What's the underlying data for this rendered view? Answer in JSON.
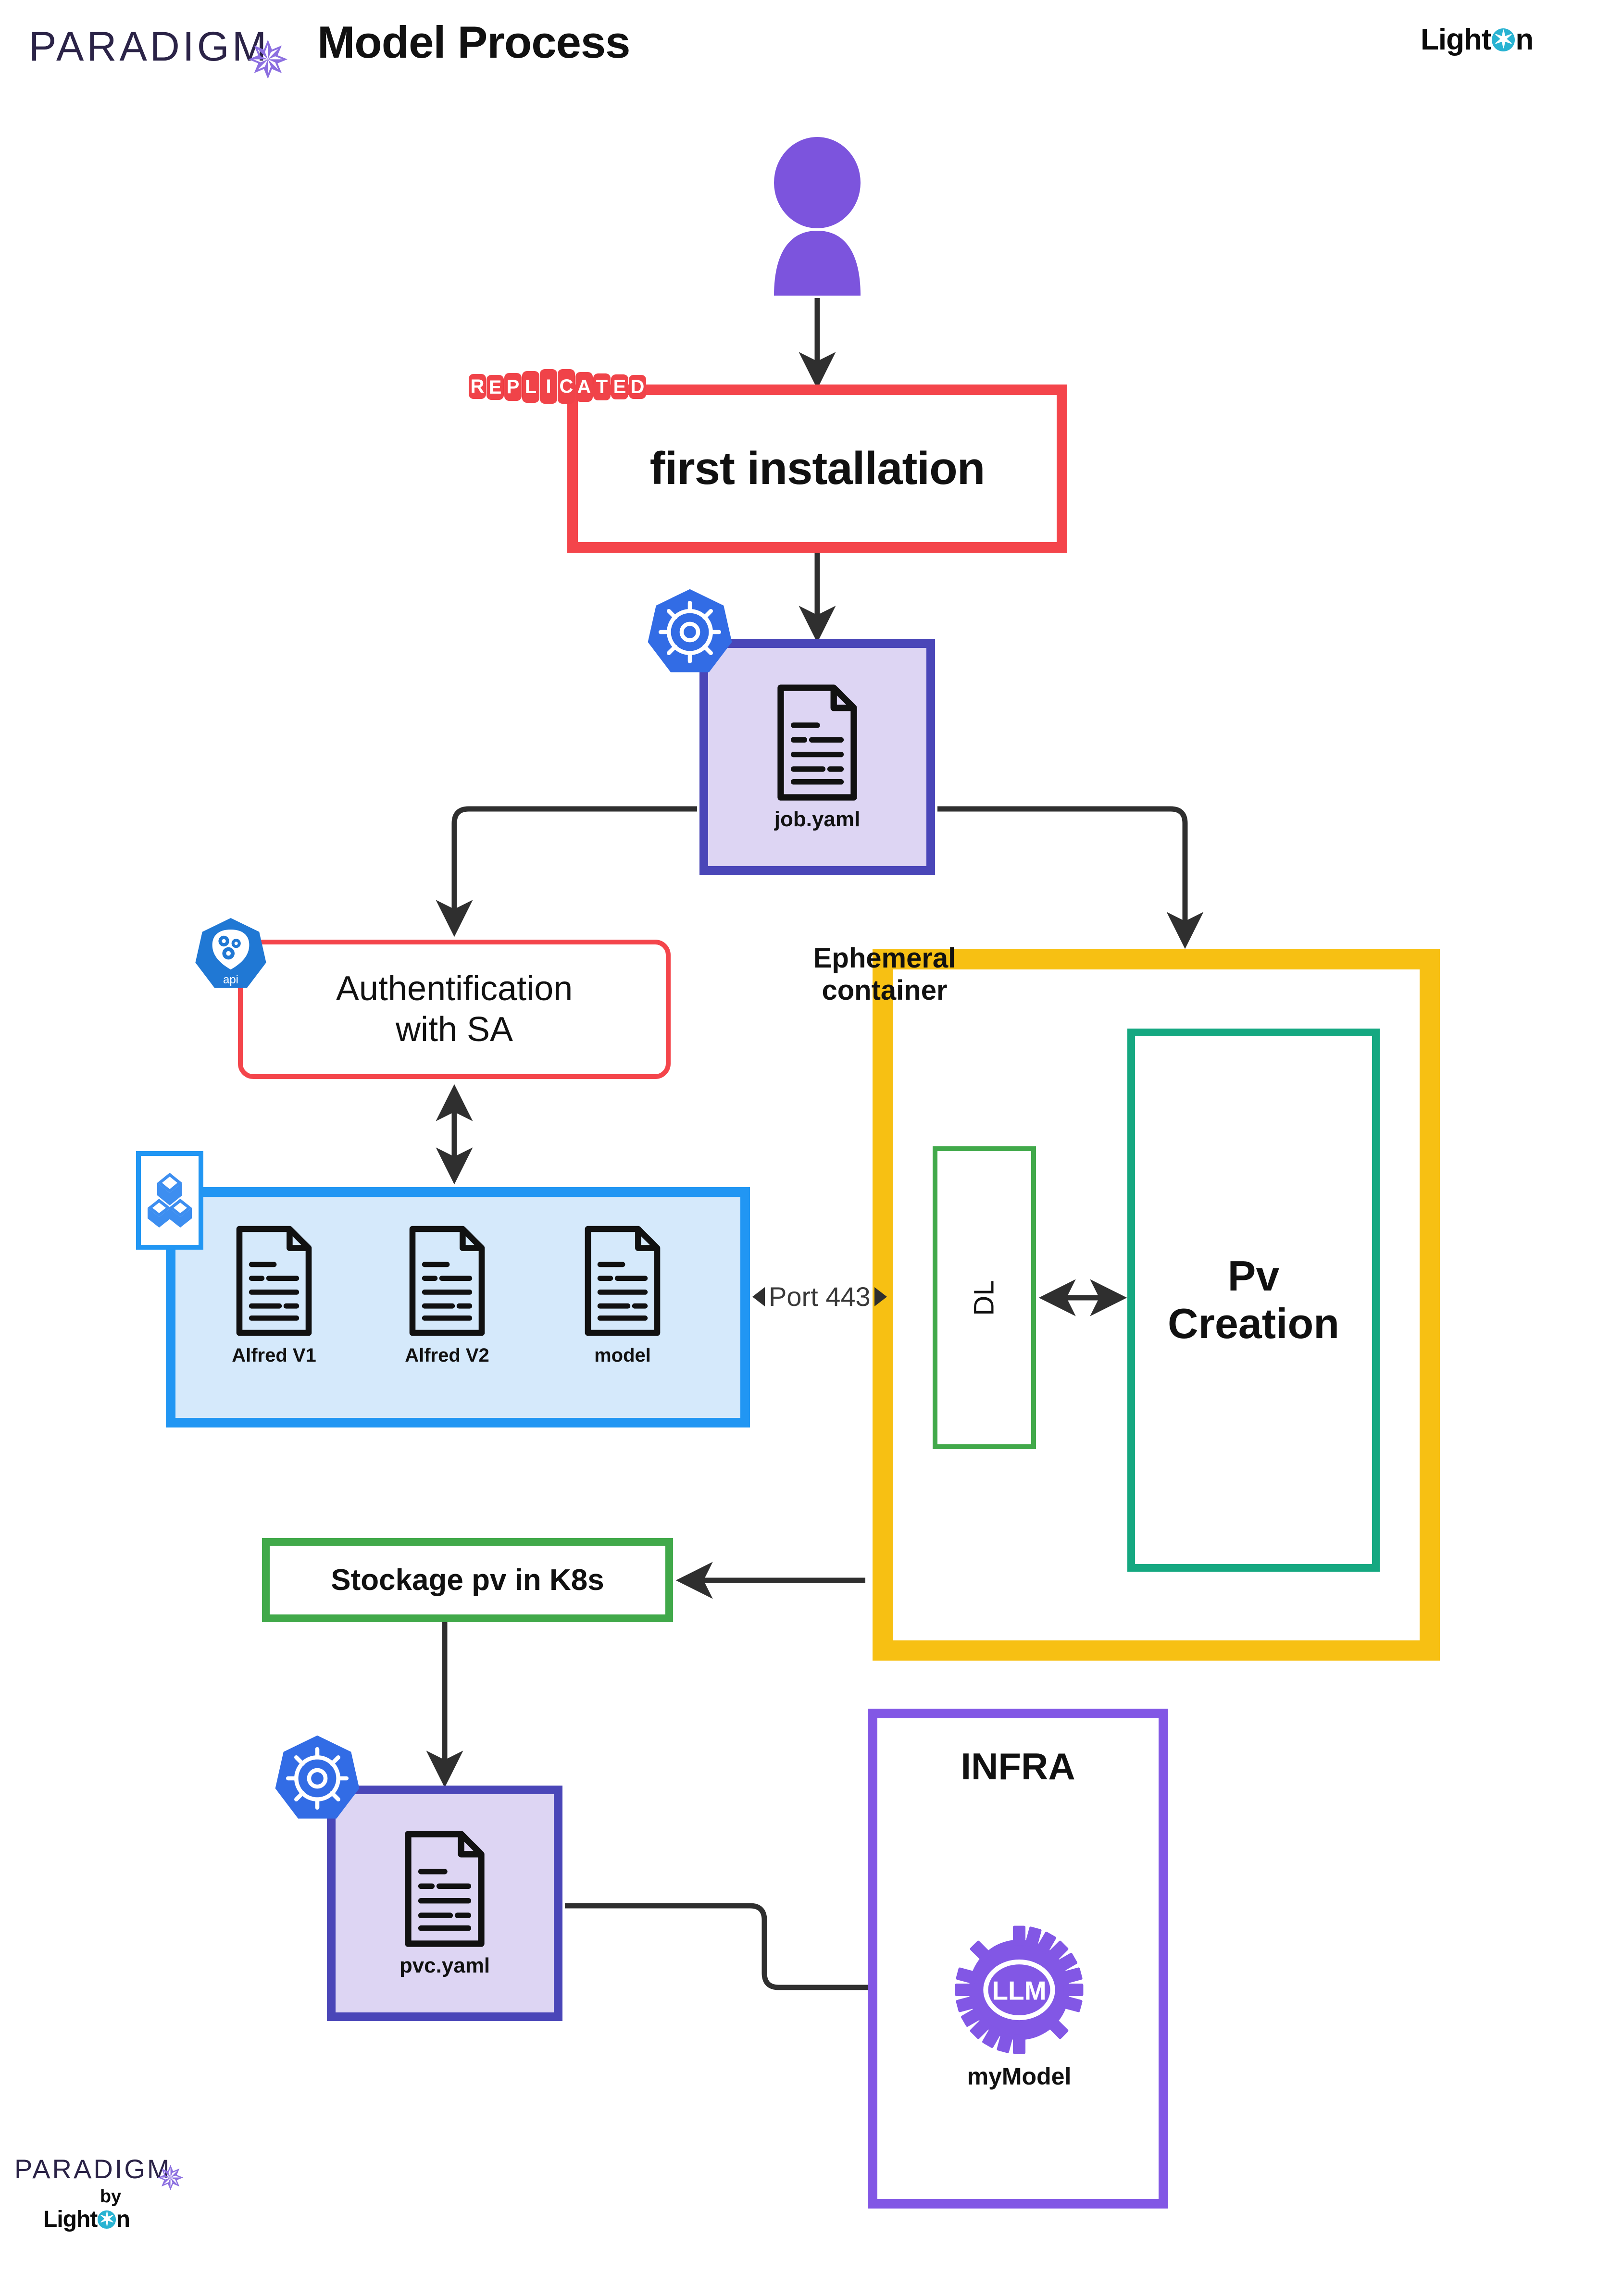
{
  "header": {
    "brand": "PARADIGM",
    "brand_star_icon": "four-point-star-icon",
    "title": "Model Process",
    "company_logo": "LightOn",
    "company_logo_pre": "Light",
    "company_logo_post": "n"
  },
  "colors": {
    "replicated_red": "#f04349",
    "first_install_border": "#f4454b",
    "k8s_blue": "#326ce5",
    "yaml_border": "#4a46b8",
    "yaml_fill": "#ddd5f3",
    "auth_border": "#f4454b",
    "store_border": "#2196f3",
    "store_fill": "#d5e9fb",
    "ephemeral_yellow": "#f7c013",
    "dl_green": "#41a94a",
    "pv_teal": "#15a881",
    "stockage_green": "#41a94a",
    "infra_purple": "#8257e5",
    "user_purple": "#7c54dd",
    "lighton_cyan": "#29b3d2",
    "paradigm_navy": "#2b2347",
    "connector_dark": "#2f2f2f"
  },
  "nodes": {
    "user": {
      "icon": "user-avatar-icon"
    },
    "replicated_badge": {
      "letters": [
        "R",
        "E",
        "P",
        "L",
        "I",
        "C",
        "A",
        "T",
        "E",
        "D"
      ],
      "text": "REPLICATED"
    },
    "first_installation": {
      "label": "first installation"
    },
    "job_yaml": {
      "label": "job.yaml",
      "icon": "document-icon",
      "platform_icon": "kubernetes-icon"
    },
    "authentification": {
      "line1": "Authentification",
      "line2": "with SA",
      "platform_icon": "kubernetes-api-icon",
      "platform_icon_label": "api"
    },
    "storage": {
      "icon": "storage-blocks-icon",
      "files": [
        {
          "label": "Alfred V1",
          "icon": "document-icon"
        },
        {
          "label": "Alfred V2",
          "icon": "document-icon"
        },
        {
          "label": "model",
          "icon": "document-icon"
        }
      ]
    },
    "ephemeral_container": {
      "line1": "Ephemeral",
      "line2": "container"
    },
    "dl": {
      "label": "DL"
    },
    "pv_creation": {
      "line1": "Pv",
      "line2": "Creation"
    },
    "port": {
      "label": "Port 443"
    },
    "stockage": {
      "label": "Stockage pv in K8s"
    },
    "pvc_yaml": {
      "label": "pvc.yaml",
      "icon": "document-icon",
      "platform_icon": "kubernetes-icon"
    },
    "infra": {
      "title": "INFRA"
    },
    "my_model": {
      "gear_text": "LLM",
      "label": "myModel",
      "icon": "gear-llm-icon"
    }
  },
  "footer": {
    "brand": "PARADIGM",
    "brand_star_icon": "four-point-star-icon",
    "by": "by",
    "company_logo_pre": "Light",
    "company_logo_post": "n"
  }
}
